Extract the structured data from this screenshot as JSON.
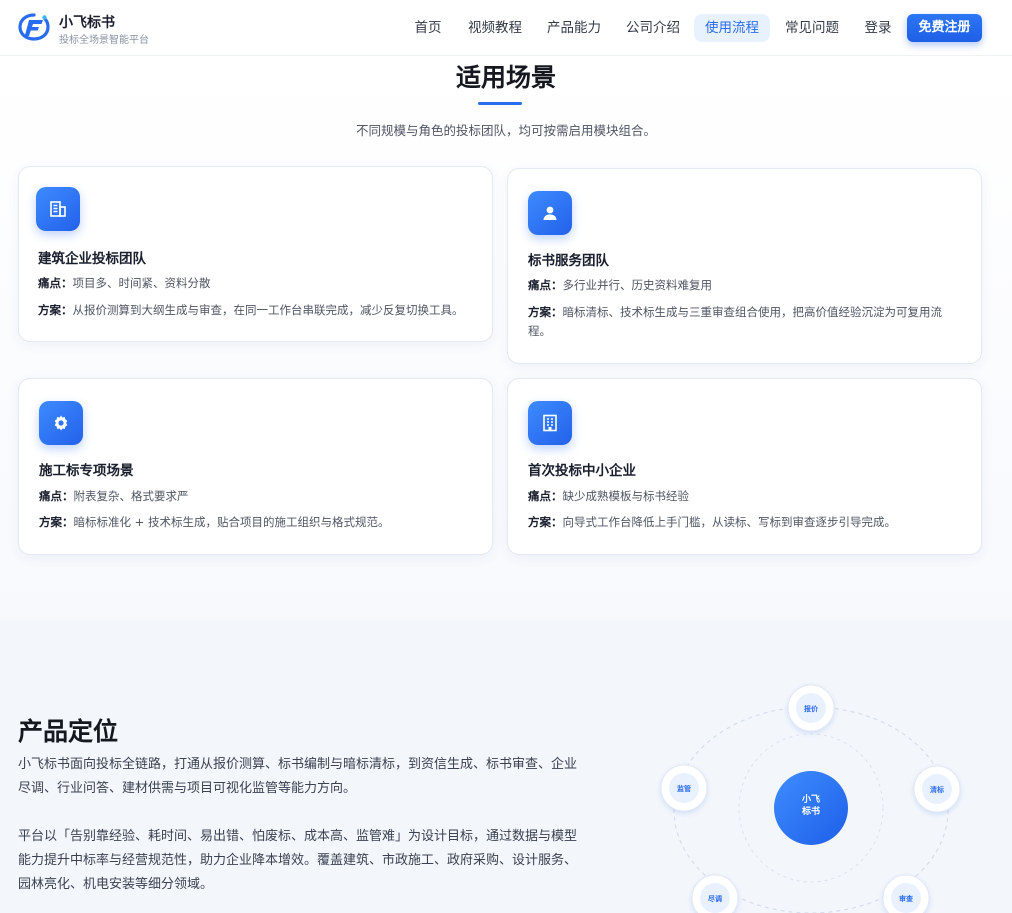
{
  "header": {
    "title": "小飞标书",
    "subtitle": "投标全场景智能平台",
    "nav": [
      "首页",
      "视频教程",
      "产品能力",
      "公司介绍",
      "使用流程",
      "常见问题",
      "登录"
    ],
    "active_nav": "使用流程",
    "cta": "免费注册"
  },
  "scenarios": {
    "title": "适用场景",
    "subtitle": "不同规模与角色的投标团队，均可按需启用模块组合。",
    "pain_label": "痛点：",
    "plan_label": "方案：",
    "cards": [
      {
        "icon": "building-icon",
        "title": "建筑企业投标团队",
        "pain": "项目多、时间紧、资料分散",
        "plan": "从报价测算到大纲生成与审查，在同一工作台串联完成，减少反复切换工具。"
      },
      {
        "icon": "user-icon",
        "title": "标书服务团队",
        "pain": "多行业并行、历史资料难复用",
        "plan": "暗标清标、技术标生成与三重审查组合使用，把高价值经验沉淀为可复用流程。"
      },
      {
        "icon": "gear-icon",
        "title": "施工标专项场景",
        "pain": "附表复杂、格式要求严",
        "plan": "暗标标准化 + 技术标生成，贴合项目的施工组织与格式规范。"
      },
      {
        "icon": "office-icon",
        "title": "首次投标中小企业",
        "pain": "缺少成熟模板与标书经验",
        "plan": "向导式工作台降低上手门槛，从读标、写标到审查逐步引导完成。"
      }
    ]
  },
  "positioning": {
    "title": "产品定位",
    "para1": "小飞标书面向投标全链路，打通从报价测算、标书编制与暗标清标，到资信生成、标书审查、企业尽调、行业问答、建材供需与项目可视化监管等能力方向。",
    "para2": "平台以「告别靠经验、耗时间、易出错、怕废标、成本高、监管难」为设计目标，通过数据与模型能力提升中标率与经营规范性，助力企业降本增效。覆盖建筑、市政施工、政府采购、设计服务、园林亮化、机电安装等细分领域。"
  },
  "orbit": {
    "center_line1": "小飞",
    "center_line2": "标书",
    "nodes": [
      "报价",
      "清标",
      "审查",
      "尽调",
      "监管"
    ]
  },
  "colors": {
    "brand": "#2a6cf0",
    "brand_light": "#e8f1fe",
    "text_dark": "#1a1f2e"
  }
}
